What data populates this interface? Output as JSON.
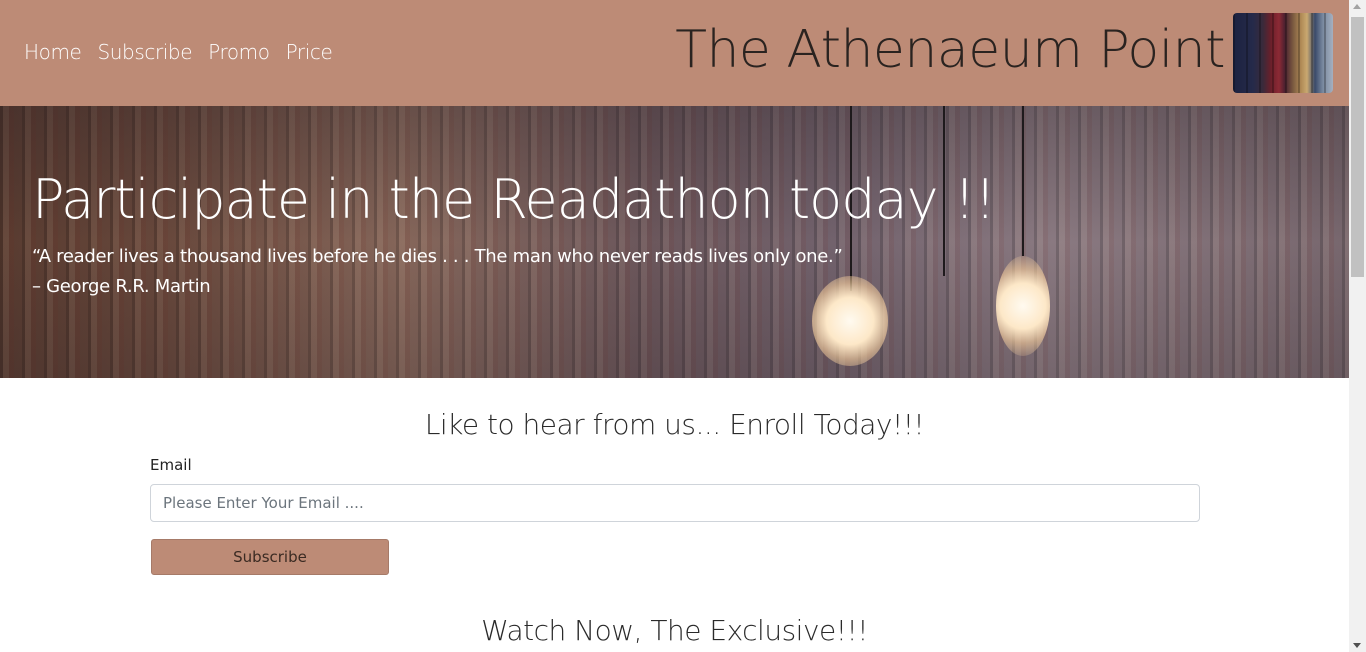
{
  "header": {
    "nav": [
      "Home",
      "Subscribe",
      "Promo",
      "Price"
    ],
    "brand_title": "The Athenaeum Point",
    "logo_icon": "books-logo"
  },
  "hero": {
    "heading": "Participate in the Readathon today !!",
    "quote_line1": "“A reader lives a thousand lives before he dies . . . The man who never reads lives only one.”",
    "quote_line2": "– George R.R. Martin"
  },
  "enroll": {
    "title": "Like to hear from us... Enroll Today!!!",
    "email_label": "Email",
    "email_placeholder": "Please Enter Your Email ....",
    "email_value": "",
    "subscribe_label": "Subscribe"
  },
  "watch": {
    "title": "Watch Now, The Exclusive!!!"
  },
  "colors": {
    "accent": "#bd8b76",
    "text_dark": "#2a2320"
  }
}
